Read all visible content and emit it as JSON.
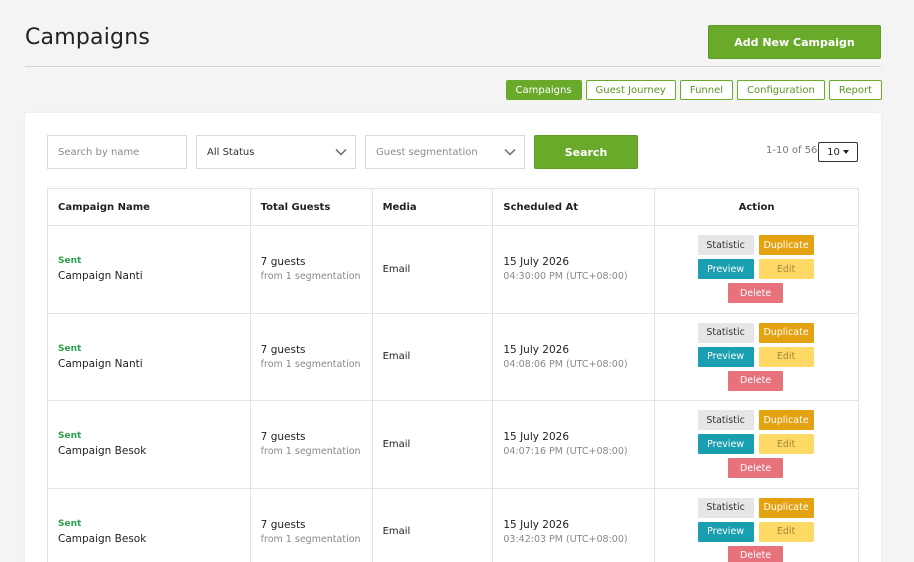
{
  "header": {
    "title": "Campaigns",
    "add_button": "Add New Campaign"
  },
  "tabs": [
    {
      "label": "Campaigns",
      "active": true
    },
    {
      "label": "Guest Journey",
      "active": false
    },
    {
      "label": "Funnel",
      "active": false
    },
    {
      "label": "Configuration",
      "active": false
    },
    {
      "label": "Report",
      "active": false
    }
  ],
  "filters": {
    "search_placeholder": "Search by name",
    "status_value": "All Status",
    "segmentation_placeholder": "Guest segmentation",
    "search_button": "Search"
  },
  "pagination": {
    "range": "1-10 of 56",
    "page_size": "10"
  },
  "table": {
    "columns": [
      "Campaign Name",
      "Total Guests",
      "Media",
      "Scheduled At",
      "Action"
    ],
    "actions": {
      "statistic": "Statistic",
      "duplicate": "Duplicate",
      "preview": "Preview",
      "edit": "Edit",
      "delete": "Delete"
    },
    "rows": [
      {
        "status": "Sent",
        "name": "Campaign Nanti",
        "guests": "7 guests",
        "guests_sub": "from 1 segmentation",
        "media": "Email",
        "date": "15 July 2026",
        "time": "04:30:00 PM (UTC+08:00)"
      },
      {
        "status": "Sent",
        "name": "Campaign Nanti",
        "guests": "7 guests",
        "guests_sub": "from 1 segmentation",
        "media": "Email",
        "date": "15 July 2026",
        "time": "04:08:06 PM (UTC+08:00)"
      },
      {
        "status": "Sent",
        "name": "Campaign Besok",
        "guests": "7 guests",
        "guests_sub": "from 1 segmentation",
        "media": "Email",
        "date": "15 July 2026",
        "time": "04:07:16 PM (UTC+08:00)"
      },
      {
        "status": "Sent",
        "name": "Campaign Besok",
        "guests": "7 guests",
        "guests_sub": "from 1 segmentation",
        "media": "Email",
        "date": "15 July 2026",
        "time": "03:42:03 PM (UTC+08:00)"
      }
    ]
  },
  "colors": {
    "brand_green": "#6aaa2a",
    "status_sent": "#2aa24a",
    "duplicate": "#e4a210",
    "preview": "#1a9fb0",
    "edit": "#ffd966",
    "delete": "#e8727c"
  },
  "icons": {
    "status_dropdown": "chevron-down-icon",
    "segmentation_dropdown": "chevron-down-icon",
    "page_size_caret": "caret-down-icon"
  }
}
